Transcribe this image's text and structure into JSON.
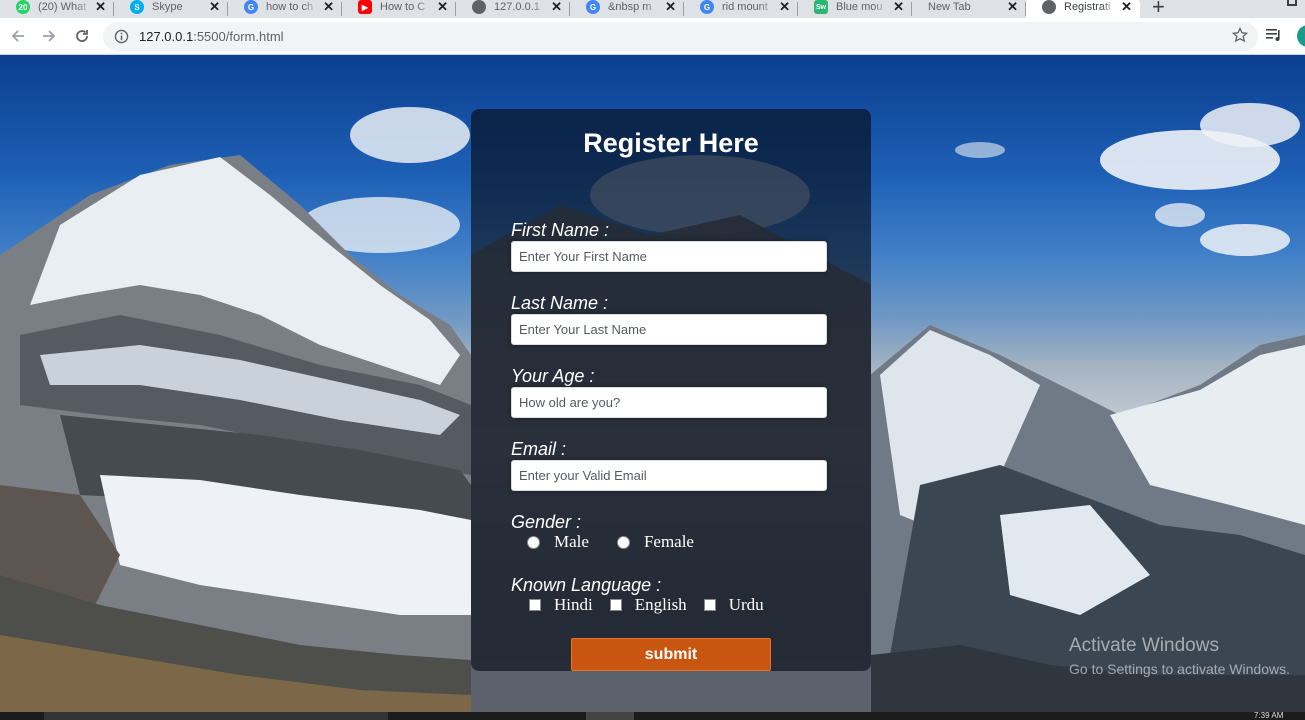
{
  "browser": {
    "tabs": [
      {
        "title": "(20) What",
        "icon": "whatsapp-icon",
        "color": "#25d366",
        "badge": "20"
      },
      {
        "title": "Skype",
        "icon": "skype-icon",
        "color": "#00aff0",
        "badge": "S"
      },
      {
        "title": "how to ch",
        "icon": "google-icon",
        "color": "#4285f4",
        "badge": "G"
      },
      {
        "title": "How to C",
        "icon": "youtube-icon",
        "color": "#ff0000",
        "badge": "▶"
      },
      {
        "title": "127.0.0.1",
        "icon": "globe-icon",
        "color": "#5f6368",
        "badge": ""
      },
      {
        "title": "&nbsp m",
        "icon": "google-icon",
        "color": "#4285f4",
        "badge": "G"
      },
      {
        "title": "rid mount",
        "icon": "google-icon",
        "color": "#4285f4",
        "badge": "G"
      },
      {
        "title": "Blue mou",
        "icon": "sw-icon",
        "color": "#2bb673",
        "badge": "Sw"
      },
      {
        "title": "New Tab",
        "icon": "",
        "color": "",
        "badge": ""
      },
      {
        "title": "Registrati",
        "icon": "globe-icon",
        "color": "#5f6368",
        "badge": "",
        "active": true
      }
    ],
    "url_host": "127.0.0.1",
    "url_path": ":5500/form.html"
  },
  "form": {
    "title": "Register Here",
    "first_name": {
      "label": "First Name :",
      "placeholder": "Enter Your First Name"
    },
    "last_name": {
      "label": "Last Name :",
      "placeholder": "Enter Your Last Name"
    },
    "age": {
      "label": "Your Age :",
      "placeholder": "How old are you?"
    },
    "email": {
      "label": "Email :",
      "placeholder": "Enter your Valid Email"
    },
    "gender": {
      "label": "Gender :",
      "options": [
        "Male",
        "Female"
      ]
    },
    "languages": {
      "label": "Known Language :",
      "options": [
        "Hindi",
        "English",
        "Urdu"
      ]
    },
    "submit_label": "submit"
  },
  "watermark": {
    "title": "Activate Windows",
    "subtitle": "Go to Settings to activate Windows."
  },
  "taskbar": {
    "clock": "7:39 AM"
  },
  "colors": {
    "submit": "#c85510",
    "card": "#050a14"
  }
}
